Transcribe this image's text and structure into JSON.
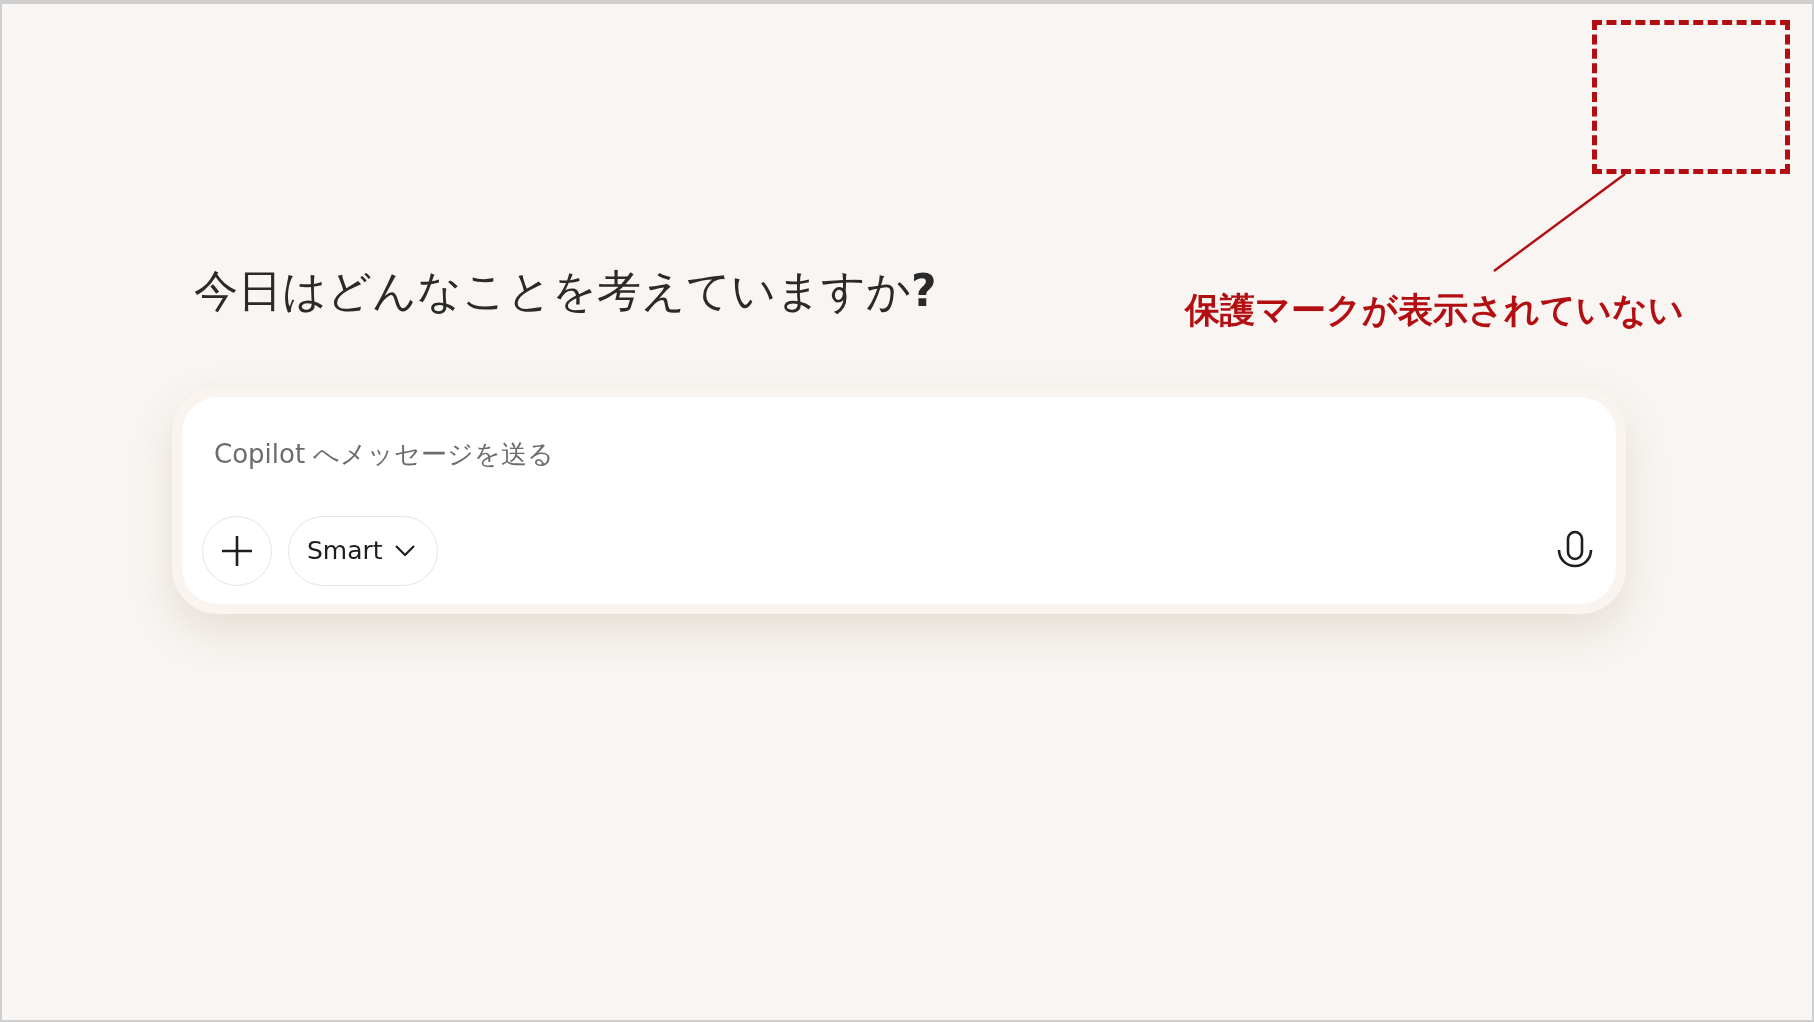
{
  "heading": "今日はどんなことを考えていますか**?**",
  "composer": {
    "placeholder": "Copilot へメッセージを送る",
    "mode_button": "Smart"
  },
  "annotation": {
    "text": "保護マークが表示されていない"
  }
}
